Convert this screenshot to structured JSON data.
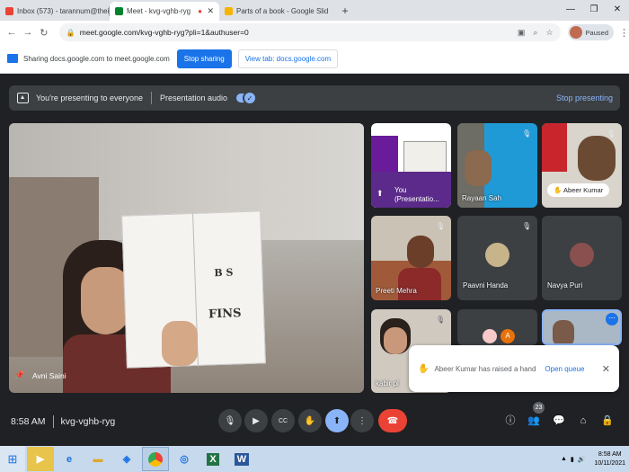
{
  "tabs": [
    {
      "title": "Inbox (573) - tarannum@theindi",
      "color": "#ea4335"
    },
    {
      "title": "Meet - kvg-vghb-ryg",
      "color": "#00832d"
    },
    {
      "title": "Parts of a book - Google Slid",
      "color": "#f4b400"
    }
  ],
  "addressbar": {
    "url": "meet.google.com/kvg-vghb-ryg?pli=1&authuser=0",
    "profile": "Paused"
  },
  "sharebar": {
    "text": "Sharing docs.google.com to meet.google.com",
    "stop": "Stop sharing",
    "view": "View tab: docs.google.com"
  },
  "presbar": {
    "presenting": "You're presenting to everyone",
    "audio": "Presentation audio",
    "stop": "Stop presenting"
  },
  "main": {
    "name": "Avni Saini"
  },
  "tiles": {
    "you": "You (Presentatio...",
    "rayaan": "Rayaan Sah",
    "abeer": "Abeer Kumar",
    "preeti": "Preeti Mehra",
    "paavni": "Paavni Handa",
    "navya": "Navya Puri",
    "kabir": "kabir pl",
    "a_initial": "A"
  },
  "notification": {
    "text": "Abeer Kumar has raised a hand",
    "action": "Open queue"
  },
  "bottom": {
    "time": "8:58 AM",
    "code": "kvg-vghb-ryg",
    "participants": "23"
  },
  "taskbar": {
    "time": "8:58 AM",
    "date": "10/11/2021"
  },
  "colors": {
    "accent": "#8ab4f8",
    "brand": "#1a73e8",
    "end": "#ea4335"
  }
}
